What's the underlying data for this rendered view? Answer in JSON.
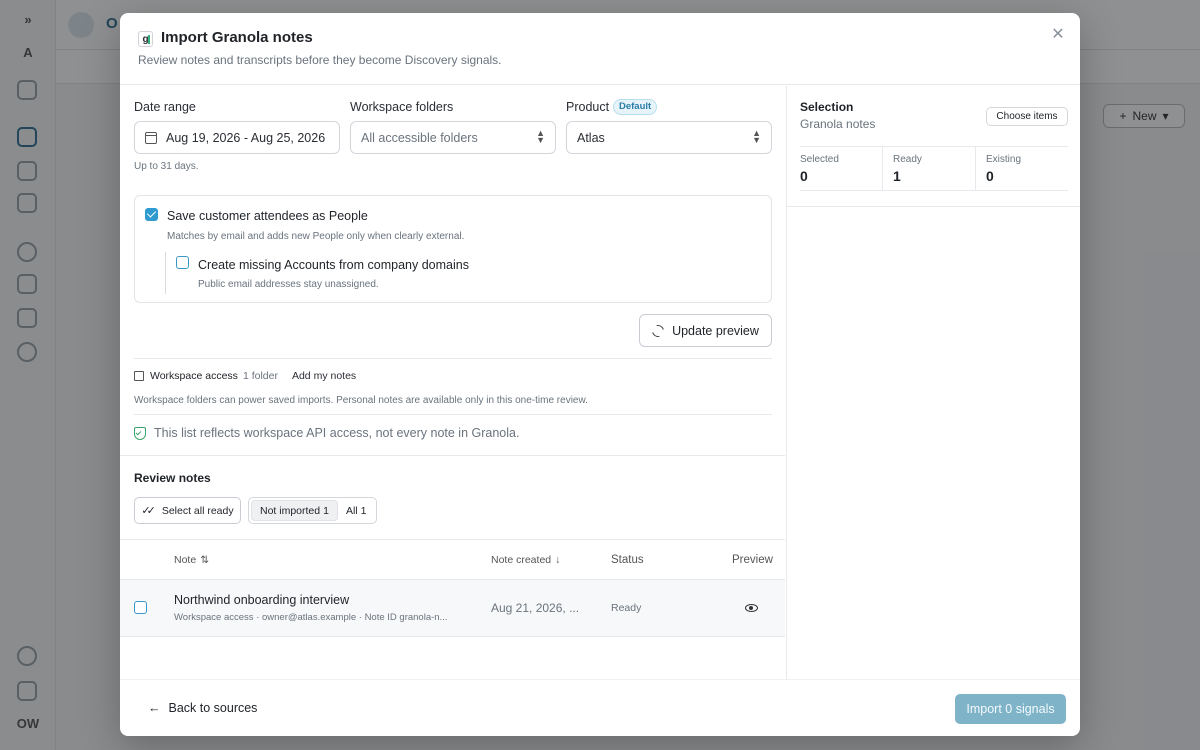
{
  "background": {
    "tab_label": "O",
    "rail_avatar": "OW",
    "new_button": "New"
  },
  "modal": {
    "title": "Import Granola notes",
    "logo_text": "g",
    "subtitle": "Review notes and transcripts before they become Discovery signals.",
    "date_range": {
      "label": "Date range",
      "value": "Aug 19, 2026 - Aug 25, 2026",
      "hint": "Up to 31 days."
    },
    "workspace_folders": {
      "label": "Workspace folders",
      "value": "All accessible folders"
    },
    "product": {
      "label": "Product",
      "badge": "Default",
      "value": "Atlas"
    },
    "options": {
      "save_attendees": {
        "label": "Save customer attendees as People",
        "desc": "Matches by email and adds new People only when clearly external.",
        "checked": true
      },
      "create_accounts": {
        "label": "Create missing Accounts from company domains",
        "desc": "Public email addresses stay unassigned.",
        "checked": false
      }
    },
    "update_preview": "Update preview",
    "workspace_access": {
      "label": "Workspace access",
      "count": "1 folder",
      "add_link": "Add my notes",
      "note": "Workspace folders can power saved imports. Personal notes are available only in this one-time review."
    },
    "api_notice": "This list reflects workspace API access, not every note in Granola.",
    "review": {
      "title": "Review notes",
      "select_all": "Select all ready",
      "filters": [
        {
          "label": "Not imported",
          "count": "1",
          "active": true
        },
        {
          "label": "All",
          "count": "1",
          "active": false
        }
      ]
    },
    "table": {
      "headers": {
        "note": "Note",
        "created": "Note created",
        "status": "Status",
        "preview": "Preview"
      },
      "rows": [
        {
          "title": "Northwind onboarding interview",
          "meta": "Workspace access · owner@atlas.example · Note ID granola-n...",
          "created": "Aug 21, 2026, ...",
          "status": "Ready"
        }
      ]
    },
    "selection": {
      "title": "Selection",
      "subtitle": "Granola notes",
      "choose_items": "Choose items",
      "stats": [
        {
          "label": "Selected",
          "value": "0"
        },
        {
          "label": "Ready",
          "value": "1"
        },
        {
          "label": "Existing",
          "value": "0"
        }
      ]
    },
    "footer": {
      "back": "Back to sources",
      "import": "Import 0 signals"
    }
  },
  "colors": {
    "accent": "#2f9bd1",
    "import_disabled": "#7eb3c8",
    "success": "#3aa36d"
  }
}
